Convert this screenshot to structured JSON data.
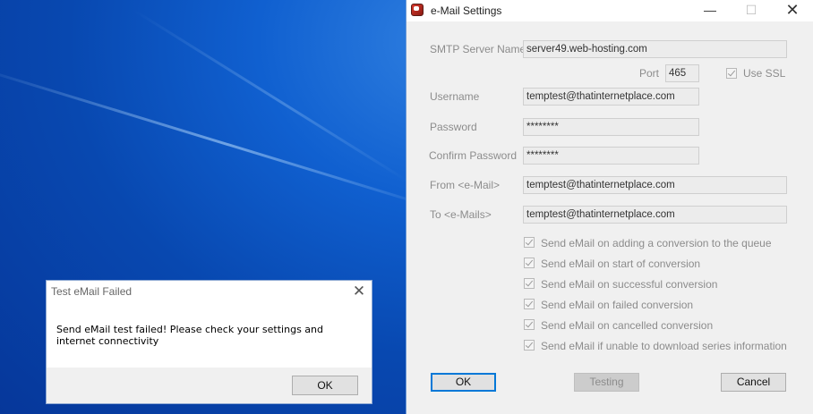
{
  "settings_window": {
    "title": "e-Mail Settings",
    "controls": {
      "minimize": "—",
      "maximize": "☐",
      "close": "✕"
    },
    "fields": {
      "smtp_server": {
        "label": "SMTP Server Name",
        "value": "server49.web-hosting.com"
      },
      "port": {
        "label": "Port",
        "value": "465"
      },
      "use_ssl": {
        "label": "Use SSL",
        "checked": true
      },
      "username": {
        "label": "Username",
        "value": "temptest@thatinternetplace.com"
      },
      "password": {
        "label": "Password",
        "value": "********"
      },
      "confirm_password": {
        "label": "Confirm Password",
        "value": "********"
      },
      "from": {
        "label": "From <e-Mail>",
        "value": "temptest@thatinternetplace.com"
      },
      "to": {
        "label": "To <e-Mails>",
        "value": "temptest@thatinternetplace.com"
      }
    },
    "options": [
      {
        "label": "Send eMail on adding a conversion to the queue",
        "checked": true
      },
      {
        "label": "Send eMail on start of conversion",
        "checked": true
      },
      {
        "label": "Send eMail on successful conversion",
        "checked": true
      },
      {
        "label": "Send eMail on failed conversion",
        "checked": true
      },
      {
        "label": "Send eMail on cancelled conversion",
        "checked": true
      },
      {
        "label": "Send eMail if unable to download series information",
        "checked": true
      }
    ],
    "buttons": {
      "ok": "OK",
      "testing": "Testing",
      "cancel": "Cancel"
    }
  },
  "error_dialog": {
    "title": "Test eMail Failed",
    "close": "✕",
    "message": "Send eMail test failed! Please check your settings and internet connectivity",
    "ok": "OK"
  }
}
